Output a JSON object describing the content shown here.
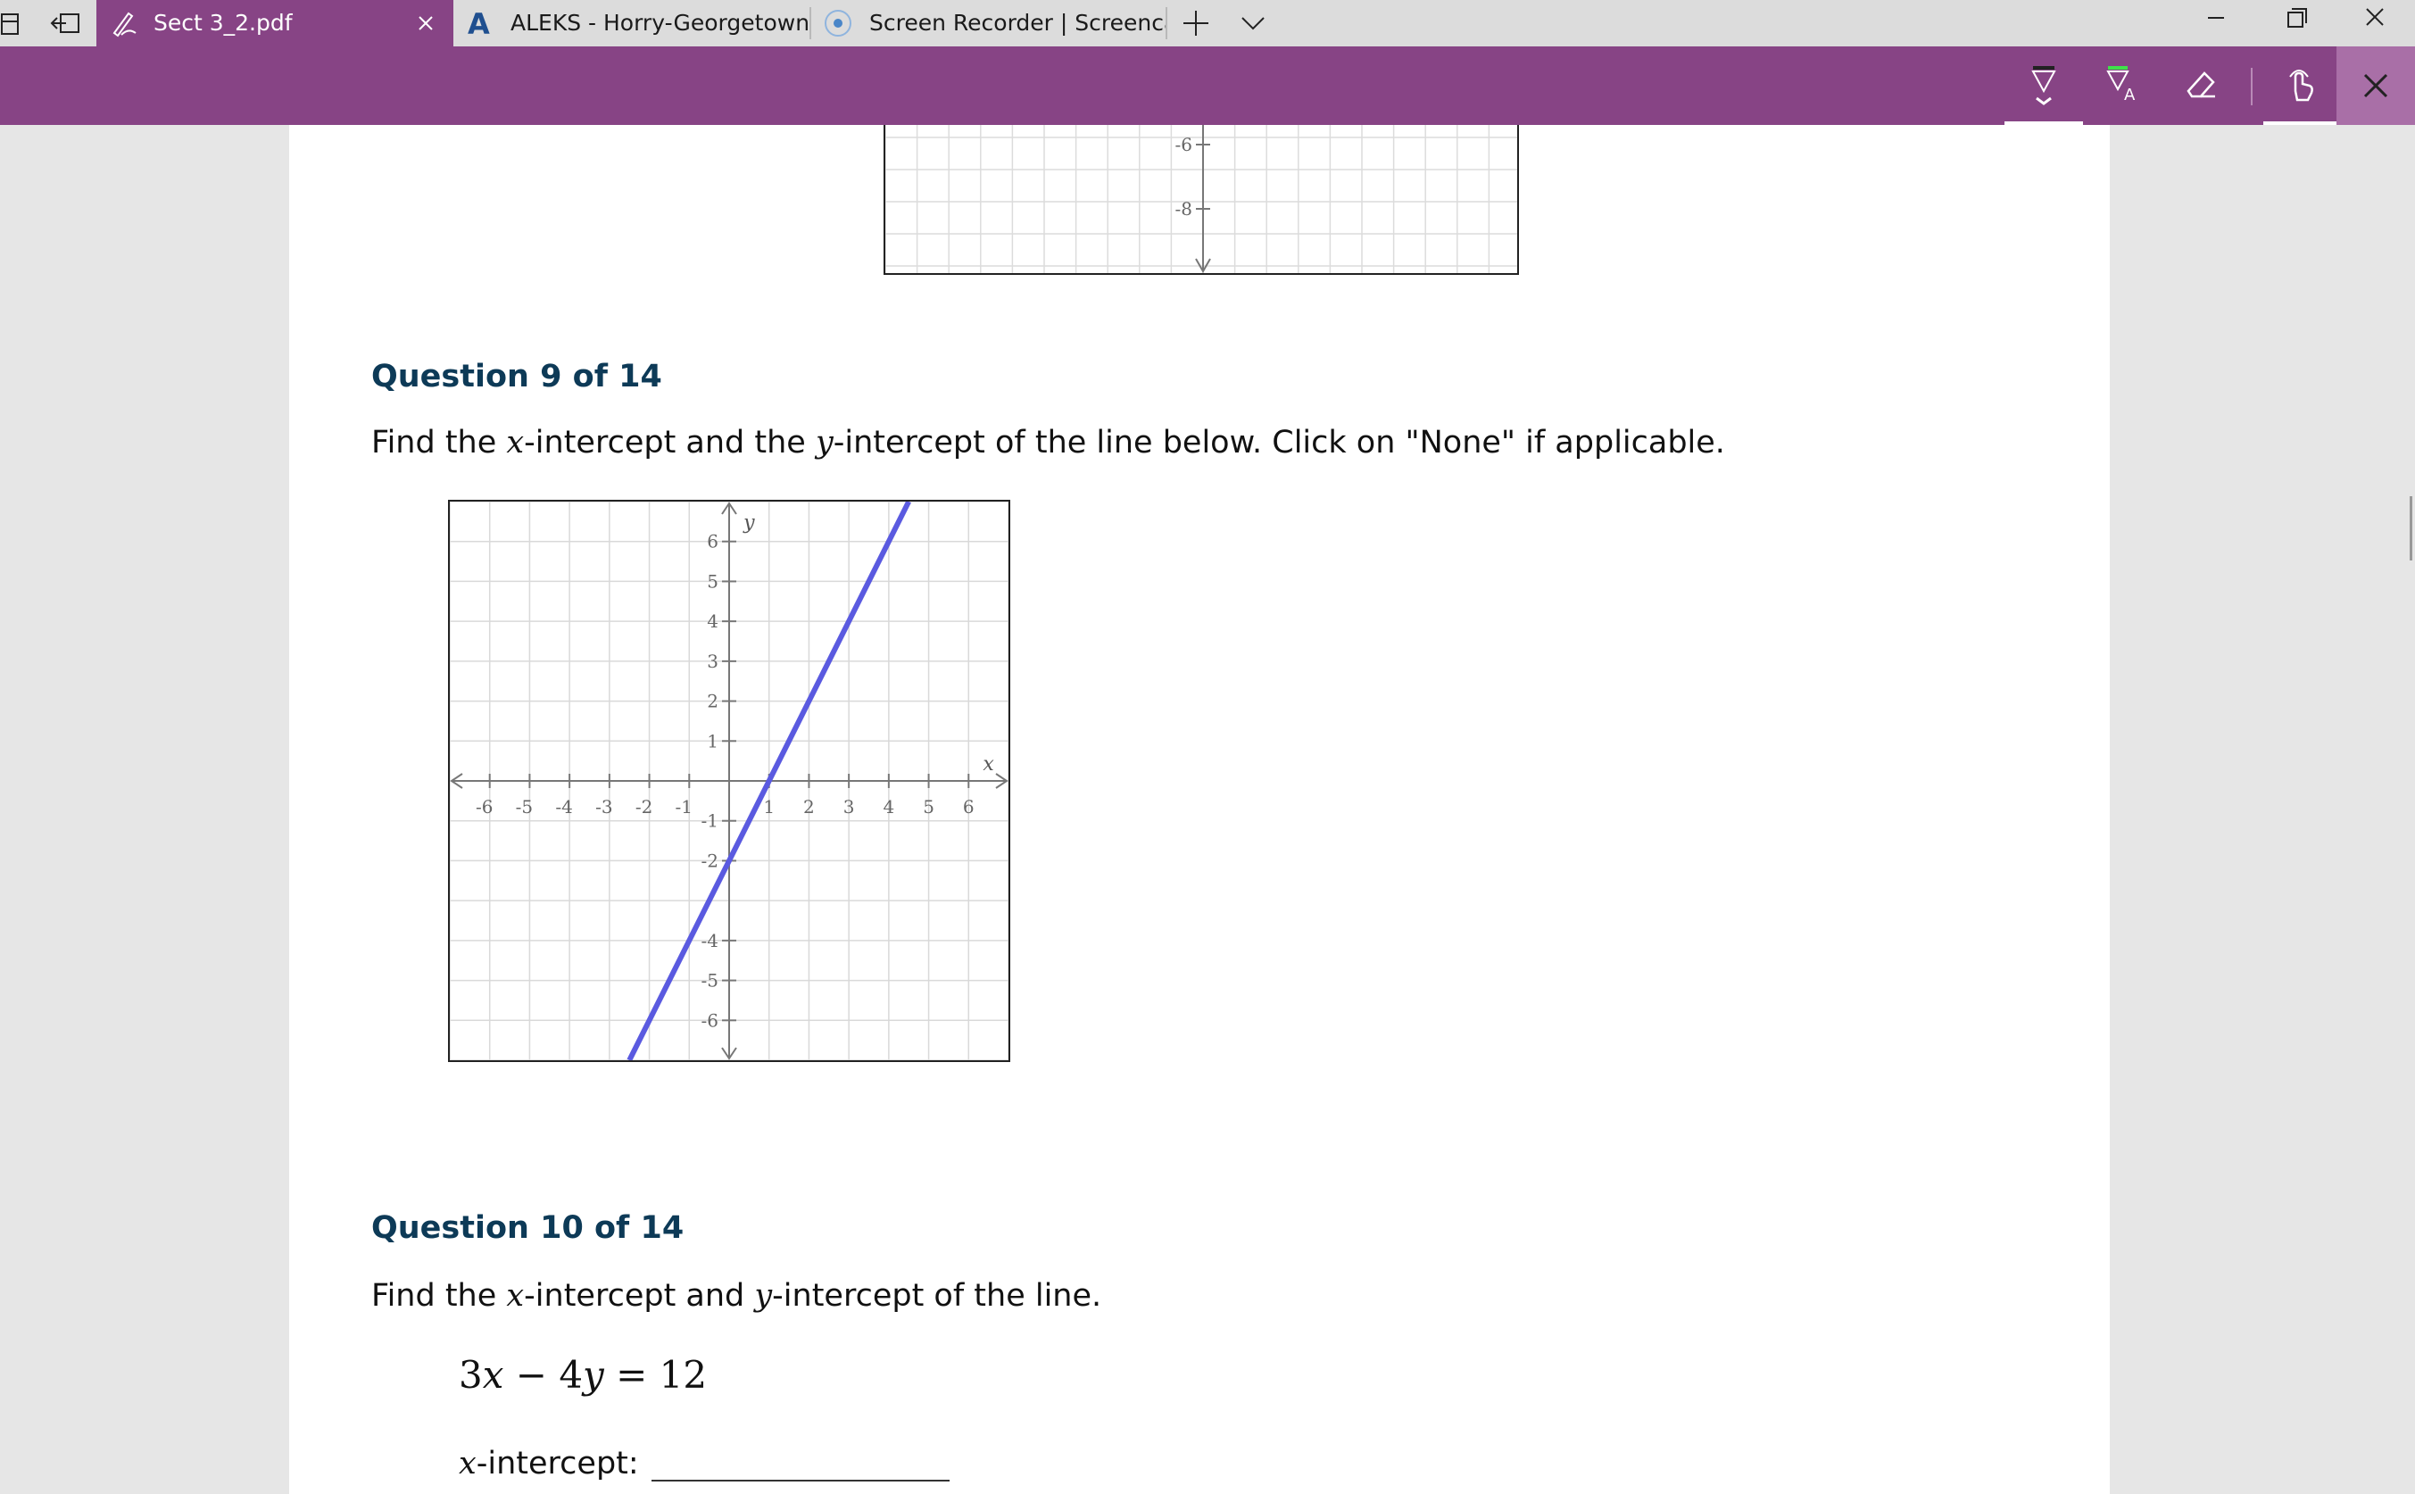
{
  "browser": {
    "tabs": [
      {
        "title": "Sect 3_2.pdf",
        "active": true
      },
      {
        "title": "ALEKS - Horry-Georgetown",
        "active": false
      },
      {
        "title": "Screen Recorder | Screencas",
        "active": false
      }
    ]
  },
  "colors": {
    "accent": "#874485",
    "question_title": "#0d3a57",
    "graph_line": "#5a5ae0"
  },
  "toolbar": {
    "icons": [
      "draw-icon",
      "highlight-text-icon",
      "eraser-icon",
      "touch-write-icon",
      "close-icon"
    ]
  },
  "document": {
    "prev_graph_ticks": [
      "-6",
      "-8"
    ],
    "question9": {
      "title": "Question 9 of 14",
      "text_parts": [
        "Find the ",
        "x",
        "-intercept and the ",
        "y",
        "-intercept of the line below. Click on \"None\" if applicable."
      ]
    },
    "question10": {
      "title": "Question 10 of 14",
      "text_parts": [
        "Find the ",
        "x",
        "-intercept and ",
        "y",
        "-intercept of the line."
      ],
      "equation_parts": [
        "3",
        "x",
        " − 4",
        "y",
        " = 12"
      ],
      "answer_parts": [
        "x",
        "-intercept:"
      ]
    }
  },
  "chart_data": {
    "type": "line",
    "xlabel": "x",
    "ylabel": "y",
    "xlim": [
      -7,
      7
    ],
    "ylim": [
      -7,
      7
    ],
    "x_ticks": [
      -6,
      -5,
      -4,
      -3,
      -2,
      -1,
      1,
      2,
      3,
      4,
      5,
      6
    ],
    "y_ticks": [
      6,
      5,
      4,
      3,
      2,
      1,
      -1,
      -2,
      -4,
      -5,
      -6
    ],
    "grid": true,
    "series": [
      {
        "x": [
          -2.5,
          4.5
        ],
        "y": [
          -7,
          7
        ]
      }
    ]
  }
}
